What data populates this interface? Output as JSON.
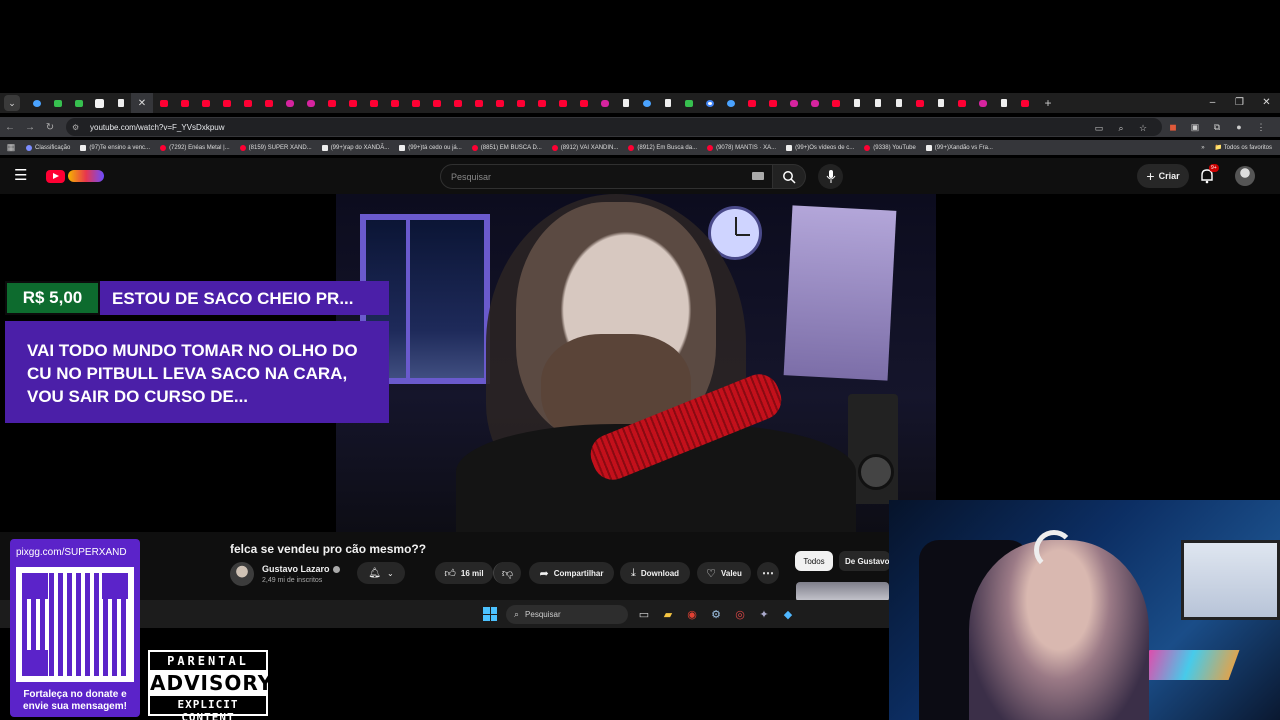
{
  "browser": {
    "address": "youtube.com/watch?v=F_YVsDxkpuw",
    "bookmarks": [
      {
        "label": "Classificação",
        "icon": "cl"
      },
      {
        "label": "(97)Te ensino a venc...",
        "icon": "tk"
      },
      {
        "label": "(7292) Enéas Metal |...",
        "icon": "yt"
      },
      {
        "label": "(8159) SUPER XAND...",
        "icon": "yt"
      },
      {
        "label": "(99+)rap do XANDÃ...",
        "icon": "tk"
      },
      {
        "label": "(99+)tá cedo ou já...",
        "icon": "tk"
      },
      {
        "label": "(8851) EM BUSCA D...",
        "icon": "yt"
      },
      {
        "label": "(8912) VAI XANDIN...",
        "icon": "yt"
      },
      {
        "label": "(8912) Em Busca da...",
        "icon": "yt"
      },
      {
        "label": "(9078) MANTIS · XA...",
        "icon": "yt"
      },
      {
        "label": "(99+)Os vídeos de c...",
        "icon": "tk"
      },
      {
        "label": "(9338) YouTube",
        "icon": "yt"
      },
      {
        "label": "(99+)Xandão vs Fra...",
        "icon": "tk"
      }
    ],
    "all_bookmarks": "Todos os favoritos",
    "tab_icons": [
      "blue",
      "grn",
      "grn",
      "wht",
      "tk",
      "active",
      "yt",
      "yt",
      "yt",
      "yt",
      "yt",
      "yt",
      "ig",
      "ig",
      "yt",
      "yt",
      "yt",
      "yt",
      "yt",
      "yt",
      "yt",
      "yt",
      "yt",
      "yt",
      "yt",
      "yt",
      "yt",
      "ig",
      "tk",
      "blue",
      "tk",
      "grn",
      "g",
      "blue",
      "yt",
      "yt",
      "ig",
      "ig",
      "yt",
      "tk",
      "tk",
      "tk",
      "yt",
      "tk",
      "yt",
      "ig",
      "tk",
      "yt"
    ]
  },
  "youtube": {
    "search_placeholder": "Pesquisar",
    "create_label": "Criar",
    "notif_badge": "9+",
    "video_title": "felca se vendeu pro cão mesmo??",
    "channel_name": "Gustavo Lazaro",
    "subscribers": "2,49 mi de inscritos",
    "likes": "16 mil",
    "share_label": "Compartilhar",
    "download_label": "Download",
    "thanks_label": "Valeu",
    "chip_all": "Todos",
    "chip_channel": "De Gustavo"
  },
  "superchat": {
    "amount": "R$ 5,00",
    "name": "ESTOU DE SACO CHEIO PR...",
    "message": "VAI TODO MUNDO TOMAR NO OLHO DO CU NO PITBULL LEVA SACO NA CARA, VOU SAIR DO CURSO DE..."
  },
  "taskbar": {
    "search_placeholder": "Pesquisar"
  },
  "donation": {
    "url": "pixgg.com/SUPERXAND",
    "text": "Fortaleça no donate e envie sua mensagem!"
  },
  "advisory": {
    "line1": "PARENTAL",
    "line2": "ADVISORY",
    "line3": "EXPLICIT CONTENT"
  },
  "colors": {
    "superchat_purple": "#4b1fa8",
    "superchat_green": "#0d6b2e",
    "donate_purple": "#5b23c9",
    "yt_red": "#ff0033"
  }
}
